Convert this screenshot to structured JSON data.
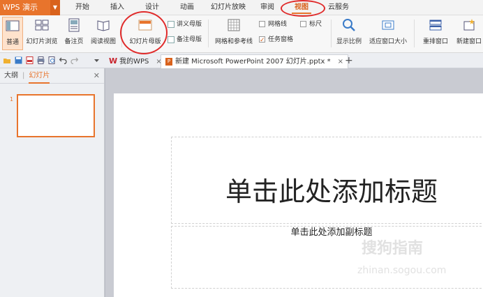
{
  "app": {
    "name": "WPS 演示"
  },
  "menu": {
    "tabs": [
      "开始",
      "插入",
      "设计",
      "动画",
      "幻灯片放映",
      "审阅",
      "视图",
      "云服务"
    ],
    "active_index": 6
  },
  "ribbon": {
    "normal": "普通",
    "slide_sorter": "幻灯片浏览",
    "notes_page": "备注页",
    "reading_view": "阅读视图",
    "slide_master": "幻灯片母版",
    "handout_master": "讲义母版",
    "notes_master": "备注母版",
    "grid_guides": "网格和参考线",
    "gridlines": "网格线",
    "ruler": "标尺",
    "task_pane": "任务窗格",
    "task_pane_checked": true,
    "zoom": "显示比例",
    "fit_window": "适应窗口大小",
    "arrange_window": "重排窗口",
    "new_window": "新建窗口"
  },
  "doc_tabs": {
    "wps_tab": "我的WPS",
    "file_tab": "新建 Microsoft PowerPoint 2007 幻灯片.pptx *"
  },
  "left_panel": {
    "outline_tab": "大纲",
    "slides_tab": "幻灯片",
    "slide_number": "1"
  },
  "slide": {
    "title": "单击此处添加标题",
    "subtitle": "单击此处添加副标题"
  },
  "watermark": {
    "line1": "搜狗指南",
    "line2": "zhinan.sogou.com"
  },
  "colors": {
    "accent": "#e8742c",
    "annotation": "#e02b2b"
  }
}
